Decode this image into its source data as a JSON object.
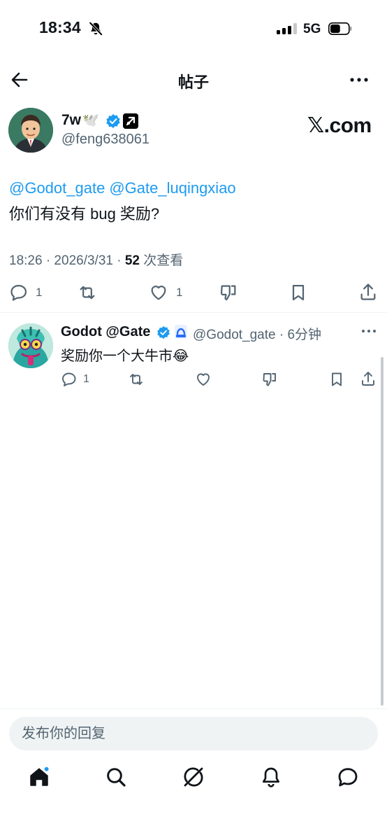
{
  "status_bar": {
    "time": "18:34",
    "network": "5G",
    "signal_bars": 3,
    "battery_level": 0.55
  },
  "header": {
    "title": "帖子"
  },
  "post": {
    "author_name": "7w",
    "author_emoji": "🕊️",
    "author_handle": "@feng638061",
    "source_label": "𝕏.com",
    "mentions": [
      "@Godot_gate",
      "@Gate_luqingxiao"
    ],
    "text": "你们有没有 bug 奖励?",
    "timestamp": "18:26 · 2026/3/31 · ",
    "views_count": "52",
    "views_label": " 次查看",
    "reply_count": "1",
    "like_count": "1"
  },
  "reply": {
    "author_name": "Godot @Gate",
    "author_handle": "@Godot_gate",
    "time_ago": " · 6分钟",
    "text": "奖励你一个大牛市😂",
    "reply_count": "1"
  },
  "composer": {
    "placeholder": "发布你的回复"
  },
  "colors": {
    "accent": "#1d9bf0",
    "text": "#0f1419",
    "muted": "#536471",
    "divider": "#eff3f4"
  },
  "icons": {
    "back": "arrow-left-icon",
    "more": "more-horizontal-icon",
    "reply": "comment-icon",
    "repost": "repost-icon",
    "like": "heart-icon",
    "dislike": "dislike-icon",
    "bookmark": "bookmark-icon",
    "share": "share-icon",
    "tabs": [
      "home-icon",
      "search-icon",
      "grok-icon",
      "notifications-icon",
      "messages-icon"
    ]
  }
}
